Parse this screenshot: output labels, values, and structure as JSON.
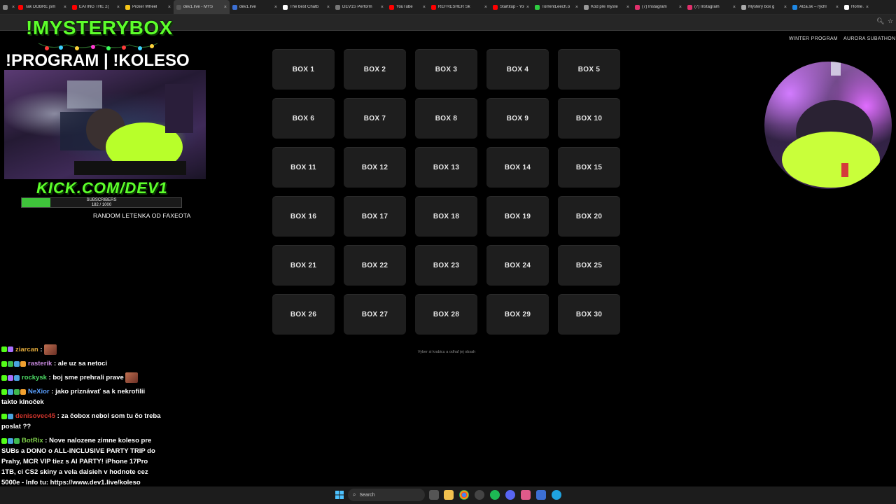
{
  "browser": {
    "tabs": [
      {
        "label": "N",
        "color": "#888888"
      },
      {
        "label": "Tak DOBRE jsm",
        "color": "#ff0000"
      },
      {
        "label": "EATING THE 2(",
        "color": "#ff0000"
      },
      {
        "label": "Picker Wheel",
        "color": "#f5c518"
      },
      {
        "label": "dev1.live - MYS",
        "color": "#555555",
        "active": true
      },
      {
        "label": "dev1.live",
        "color": "#3b6fd4"
      },
      {
        "label": "The best Chatb",
        "color": "#ffffff"
      },
      {
        "label": "DEV1S Perform",
        "color": "#777777"
      },
      {
        "label": "YouTube",
        "color": "#ff0000"
      },
      {
        "label": "REFRESHER Sk",
        "color": "#ff0000"
      },
      {
        "label": "Startitup - You",
        "color": "#ff0000"
      },
      {
        "label": "TorrentLeech.o",
        "color": "#2ecc40"
      },
      {
        "label": "Kód pre myste",
        "color": "#999999"
      },
      {
        "label": "(7) Instagram",
        "color": "#e1306c"
      },
      {
        "label": "(7) Instagram",
        "color": "#e1306c"
      },
      {
        "label": "Mystery box g",
        "color": "#aaaaaa"
      },
      {
        "label": "Alza.sk – rýchl",
        "color": "#1e88e5"
      },
      {
        "label": "Home / X",
        "color": "#ffffff"
      }
    ],
    "close_glyph": "×"
  },
  "overlay": {
    "title_line1": "!MYSTERYBOX",
    "title_line2": "!PROGRAM | !KOLESO",
    "kick_logo": "KICK.COM/DEV1",
    "subs_label": "SUBSCRIBERS",
    "subs_count": "182 / 1000",
    "subs_progress": 0.182,
    "caption": "RANDOM LETENKA OD FAXEOTA"
  },
  "nav": {
    "winter": "WINTER PROGRAM",
    "aurora": "AURORA SUBATHON"
  },
  "boxes": [
    "BOX 1",
    "BOX 2",
    "BOX 3",
    "BOX 4",
    "BOX 5",
    "BOX 6",
    "BOX 7",
    "BOX 8",
    "BOX 9",
    "BOX 10",
    "BOX 11",
    "BOX 12",
    "BOX 13",
    "BOX 14",
    "BOX 15",
    "BOX 16",
    "BOX 17",
    "BOX 18",
    "BOX 19",
    "BOX 20",
    "BOX 21",
    "BOX 22",
    "BOX 23",
    "BOX 24",
    "BOX 25",
    "BOX 26",
    "BOX 27",
    "BOX 28",
    "BOX 29",
    "BOX 30"
  ],
  "hint": "Vyber si krabicu a odhaľ jej obsah",
  "chat": [
    {
      "user": "ziarcan",
      "color": "#e0a93a",
      "text": "",
      "emote": true,
      "badges": [
        "#53fc18",
        "#a970ff"
      ]
    },
    {
      "user": "rasterik",
      "color": "#c98ae0",
      "text": "ale uz sa netoci",
      "emote": false,
      "badges": [
        "#53fc18",
        "#3fb950",
        "#4aa3df",
        "#f0a030"
      ]
    },
    {
      "user": "rockysk",
      "color": "#4cd964",
      "text": "boj sme prehrali prave",
      "emote": true,
      "badges": [
        "#53fc18",
        "#a970ff",
        "#4aa3df"
      ]
    },
    {
      "user": "NeXior",
      "color": "#5aa0ff",
      "text": "jako priznávať sa k nekrofilii takto klnoček",
      "emote": false,
      "badges": [
        "#53fc18",
        "#4aa3df",
        "#3fb950",
        "#f0a030"
      ]
    },
    {
      "user": "denisovec45",
      "color": "#d0342c",
      "text": "za čobox nebol som tu čo treba poslat ??",
      "emote": false,
      "badges": [
        "#53fc18",
        "#4aa3df"
      ]
    },
    {
      "user": "BotRix",
      "color": "#7fd14a",
      "text": "Nove nalozene zimne koleso pre SUBs a DONO o ALL-INCLUSIVE PARTY TRIP do Prahy, MCR VIP tiez s AI PARTY! iPhone 17Pro 1TB, ci CS2 skiny a vela dalsieh v hodnote cez 5000e - Info tu: https://www.dev1.live/koleso",
      "emote": false,
      "badges": [
        "#53fc18",
        "#4aa3df",
        "#3fb950"
      ]
    }
  ],
  "taskbar": {
    "search_label": "Search"
  }
}
